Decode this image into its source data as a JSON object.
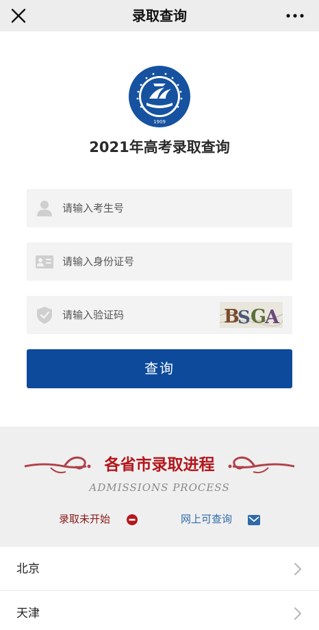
{
  "topbar": {
    "title": "录取查询"
  },
  "page": {
    "title": "2021年高考录取查询"
  },
  "logo": {
    "text": "DALIAN MARITIME UNIVERSITY",
    "year": "1909",
    "cn": "大连海事大学"
  },
  "form": {
    "exam_id_placeholder": "请输入考生号",
    "id_card_placeholder": "请输入身份证号",
    "captcha_placeholder": "请输入验证码",
    "captcha_text": "BSGA",
    "submit_label": "查询"
  },
  "process": {
    "title": "各省市录取进程",
    "subtitle": "ADMISSIONS PROCESS",
    "legend_not_started": "录取未开始",
    "legend_online": "网上可查询"
  },
  "provinces": [
    {
      "name": "北京"
    },
    {
      "name": "天津"
    }
  ],
  "colors": {
    "primary": "#0d4a9c",
    "accent_red": "#b3161c",
    "legend_red": "#8b1a1a",
    "legend_blue": "#2f6aa8",
    "ornament": "#b0414a"
  },
  "icons": {
    "close": "close-icon",
    "more": "more-icon",
    "user": "user-icon",
    "id_card": "id-card-icon",
    "shield": "shield-icon",
    "not_started": "no-entry-icon",
    "online": "mail-icon",
    "chevron": "chevron-right-icon"
  }
}
